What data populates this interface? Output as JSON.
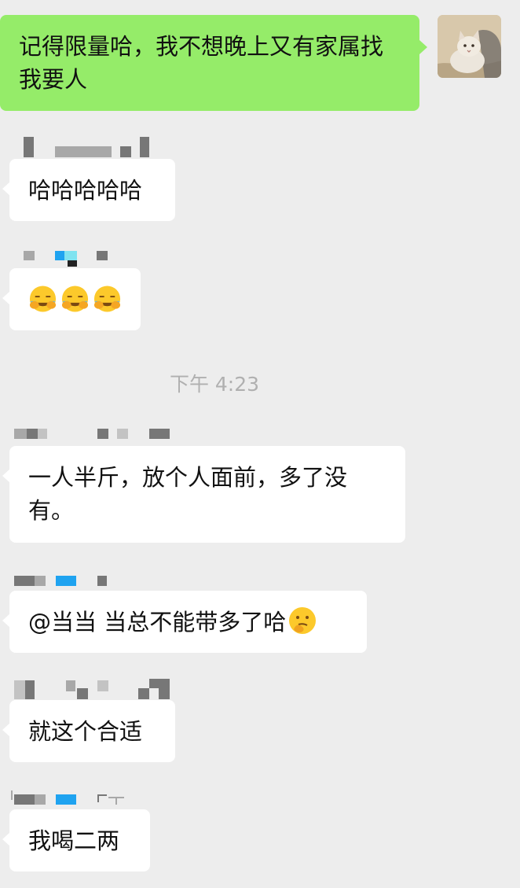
{
  "messages": {
    "m1": {
      "text": "记得限量哈，我不想晚上又有家属找我要人"
    },
    "m2": {
      "text": "哈哈哈哈哈"
    },
    "m3": {
      "emojis": [
        "face-with-tears-of-joy-covering-icon",
        "face-with-tears-of-joy-covering-icon",
        "face-with-tears-of-joy-covering-icon"
      ]
    },
    "time": "下午 4:23",
    "m4": {
      "text": "一人半斤，放个人面前，多了没有。"
    },
    "m5": {
      "text": "@当当 当总不能带多了哈"
    },
    "m6": {
      "text": "就这个合适"
    },
    "m7": {
      "text": "我喝二两"
    }
  },
  "colors": {
    "background": "#ededed",
    "outgoing_bubble": "#95ec69",
    "incoming_bubble": "#ffffff",
    "time_text": "#b0b0b0"
  }
}
